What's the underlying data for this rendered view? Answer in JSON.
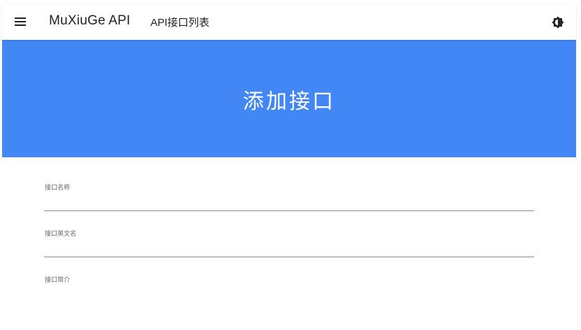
{
  "header": {
    "menu_icon": "hamburger-menu-icon",
    "brand": "MuXiuGe API",
    "nav_link": "API接口列表",
    "theme_icon": "brightness-contrast-icon"
  },
  "hero": {
    "title": "添加接口",
    "background": "#4287f5"
  },
  "form": {
    "fields": [
      {
        "label": "接口名称",
        "value": ""
      },
      {
        "label": "接口英文名",
        "value": ""
      },
      {
        "label": "接口简介",
        "value": ""
      }
    ]
  }
}
